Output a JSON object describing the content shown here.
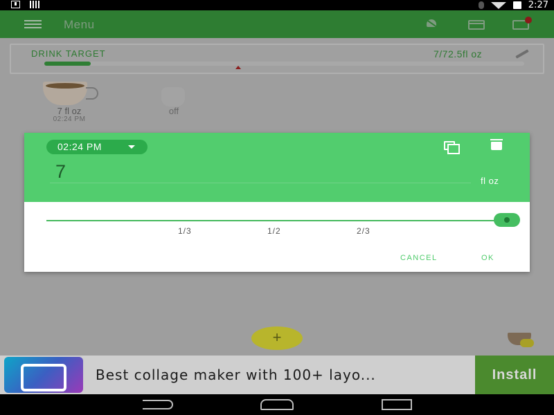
{
  "status_bar": {
    "time": "2:27",
    "icons": [
      "download-icon",
      "signal-bars-icon",
      "bluetooth-icon",
      "wifi-icon",
      "battery-charging-icon"
    ]
  },
  "app_bar": {
    "menu_label": "Menu",
    "icons": [
      "bell-off-icon",
      "calendar-icon",
      "cup-plus-icon"
    ]
  },
  "drink_target": {
    "label": "DRINK TARGET",
    "value": "7/72.5fl oz",
    "progress_fraction": 0.0966
  },
  "log_items": [
    {
      "icon": "coffee-cup-icon",
      "amount": "7 fl oz",
      "time": "02:24 PM"
    },
    {
      "icon": "hand-icon",
      "label": "off"
    }
  ],
  "dialog": {
    "time": "02:24 PM",
    "amount_value": "7",
    "unit": "fl oz",
    "slider_ticks": [
      "1/3",
      "1/2",
      "2/3"
    ],
    "slider_fraction": 1.0,
    "cancel_label": "CANCEL",
    "ok_label": "OK"
  },
  "fab": {
    "label": "+"
  },
  "ad": {
    "text": "Best collage maker with 100+ layo...",
    "install_label": "Install"
  },
  "colors": {
    "app_bar": "#2e7d32",
    "dialog_header": "#52cd6e",
    "accent": "#4ecb6a",
    "fab": "#b8b52c",
    "install": "#4b8a2e"
  }
}
